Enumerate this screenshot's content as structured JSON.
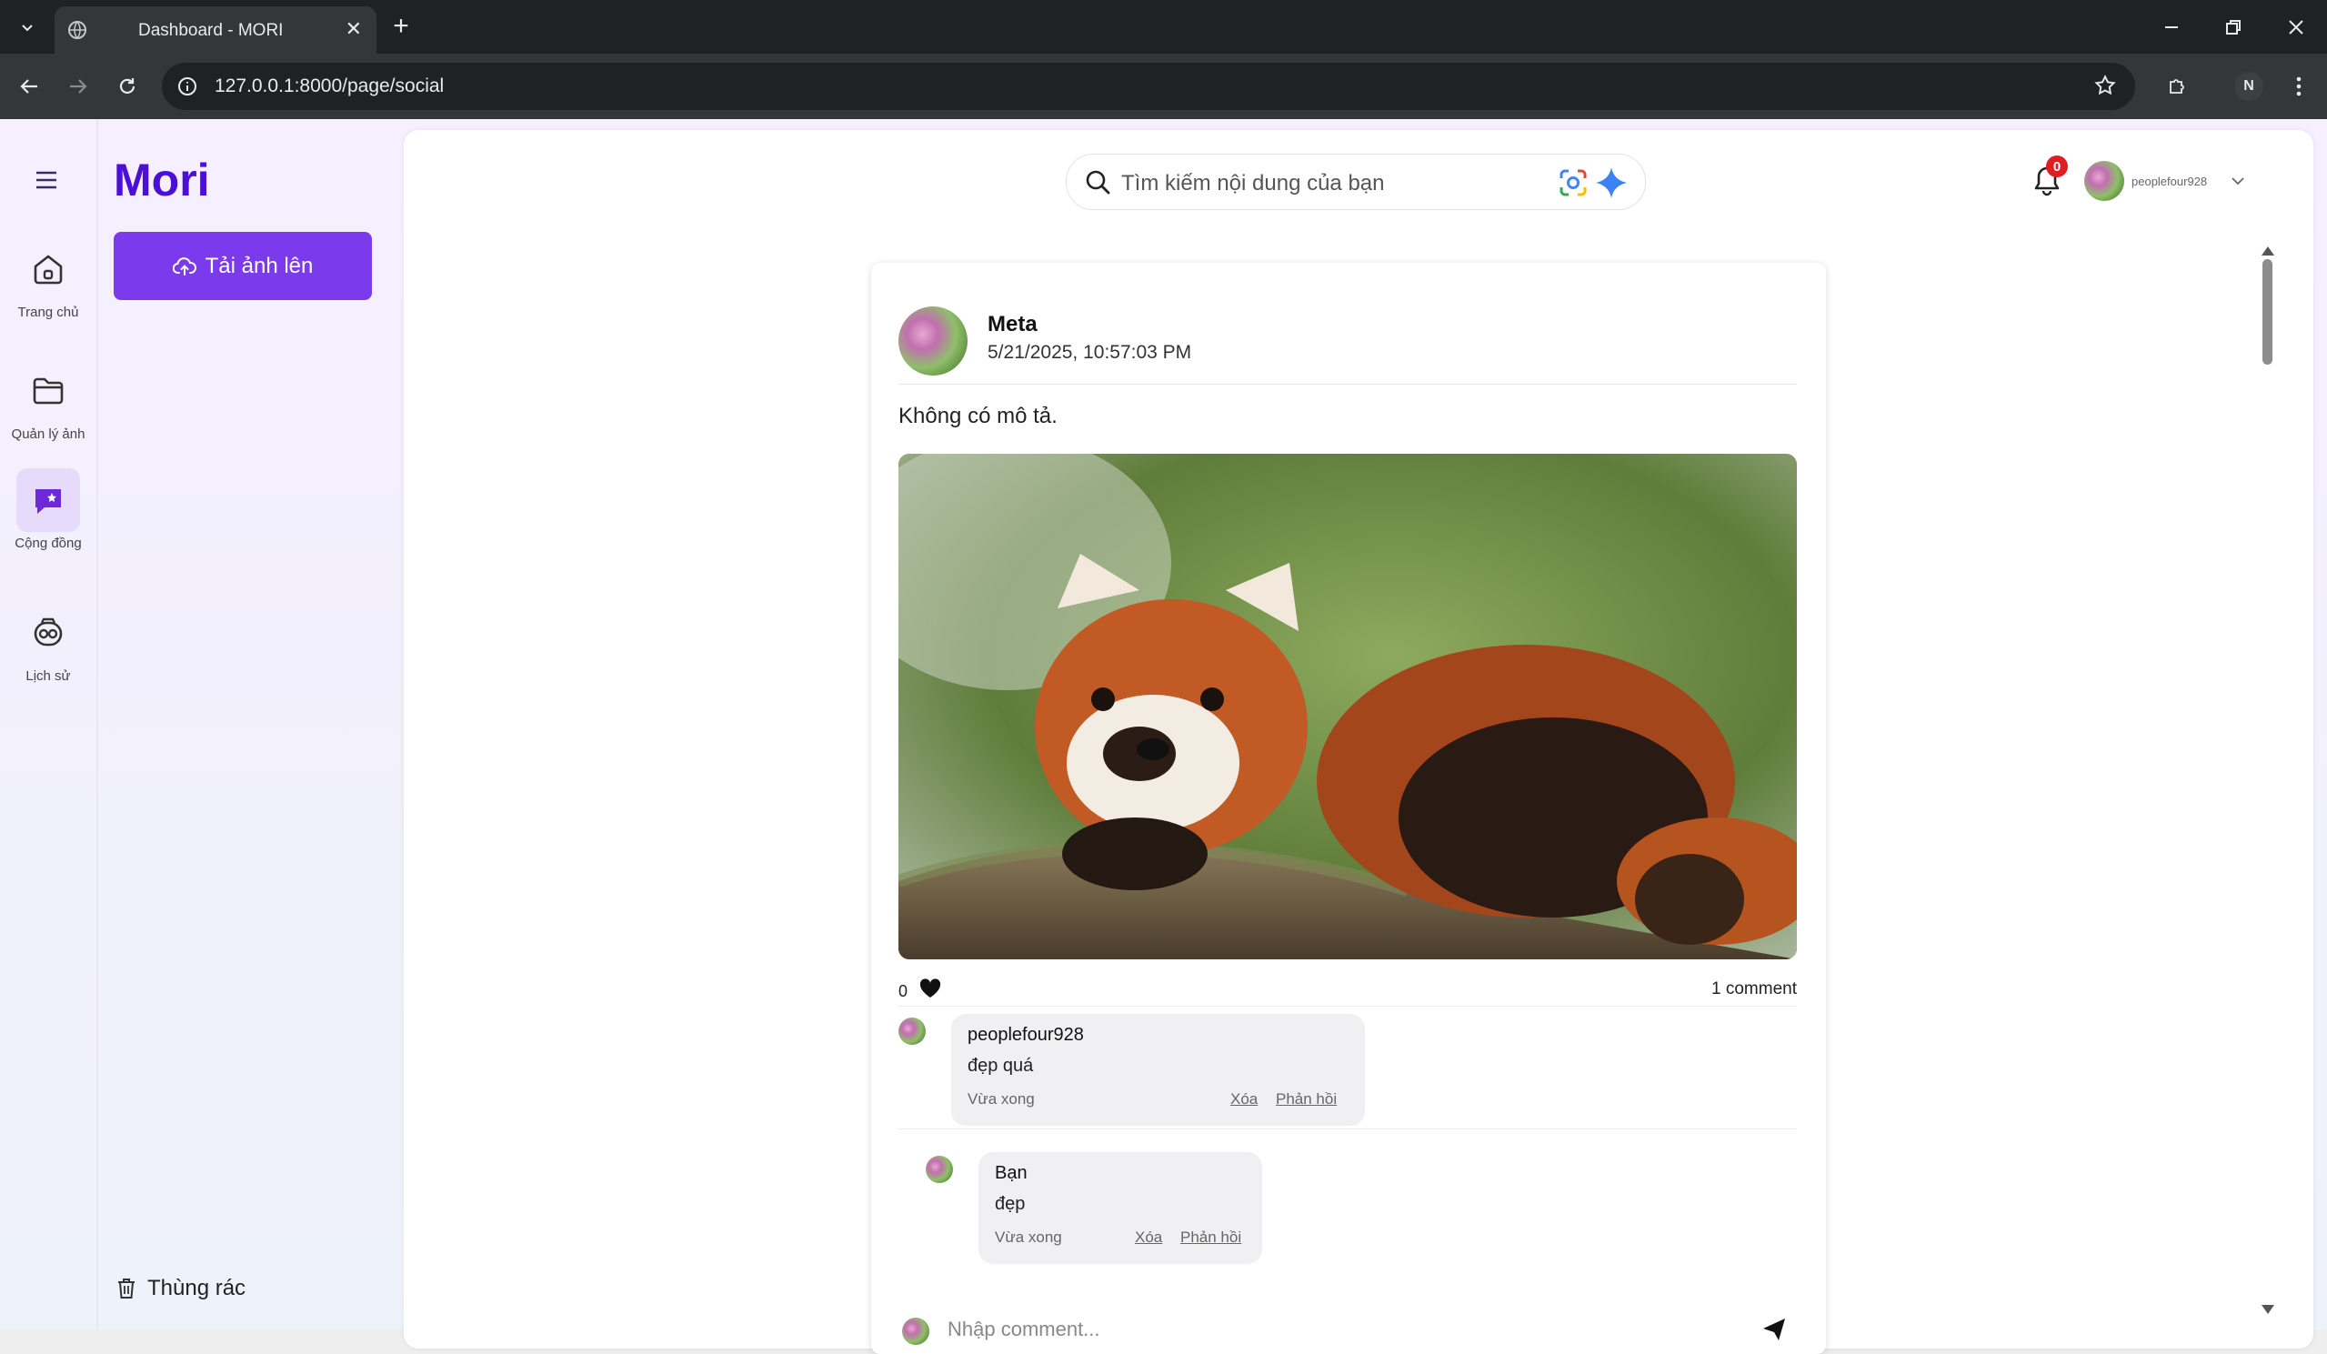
{
  "browser": {
    "tab_title": "Dashboard - MORI",
    "url": "127.0.0.1:8000/page/social",
    "profile_initial": "N"
  },
  "app": {
    "brand": "Mori",
    "upload_label": "Tải ảnh lên",
    "trash_label": "Thùng rác",
    "nav": [
      {
        "label": "Trang chủ",
        "icon": "home-icon",
        "active": false
      },
      {
        "label": "Quản lý ảnh",
        "icon": "folder-icon",
        "active": false
      },
      {
        "label": "Cộng đồng",
        "icon": "community-icon",
        "active": true
      },
      {
        "label": "Lịch sử",
        "icon": "history-icon",
        "active": false
      }
    ],
    "accent_color": "#7c3aed",
    "brand_color": "#4b0fd6"
  },
  "header": {
    "search_placeholder": "Tìm kiếm nội dung của bạn",
    "notification_count": "0",
    "username": "peoplefour928"
  },
  "post": {
    "author": "Meta",
    "timestamp": "5/21/2025, 10:57:03 PM",
    "description": "Không có mô tả.",
    "image_subject": "red panda on a tree branch",
    "like_count": "0",
    "comment_count": "1 comment",
    "comments": [
      {
        "author": "peoplefour928",
        "text": "đẹp quá",
        "time": "Vừa xong",
        "delete_label": "Xóa",
        "reply_label": "Phản hồi"
      },
      {
        "author": "Bạn",
        "text": "đẹp",
        "time": "Vừa xong",
        "delete_label": "Xóa",
        "reply_label": "Phản hồi"
      }
    ],
    "comment_placeholder": "Nhập comment..."
  }
}
